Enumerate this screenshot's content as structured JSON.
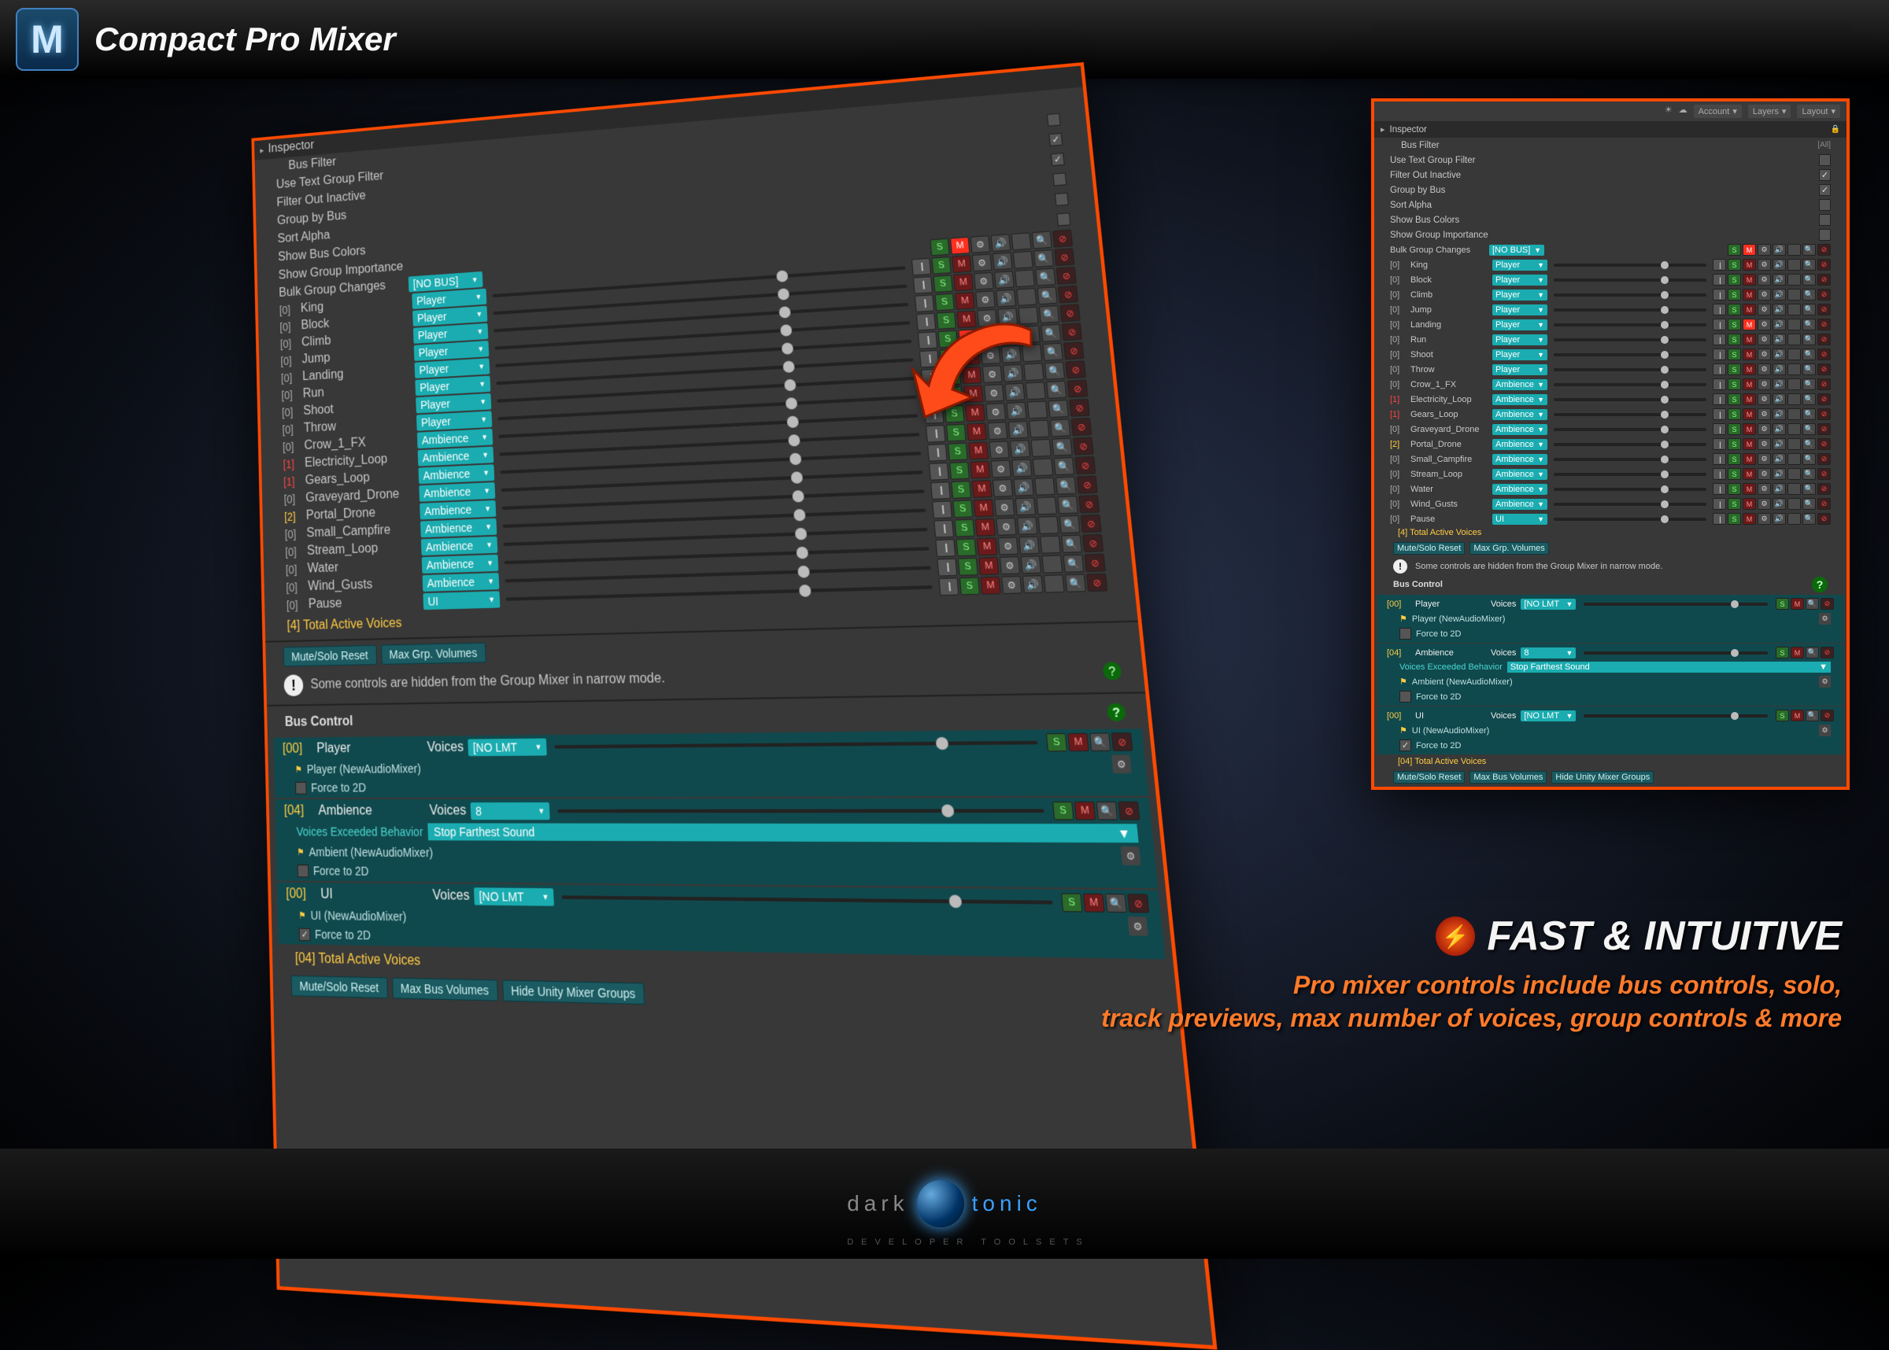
{
  "title": "Compact Pro Mixer",
  "slogan_head": "FAST & INTUITIVE",
  "slogan_body": "Pro mixer controls include bus controls, solo,\ntrack previews, max number of voices, group controls & more",
  "brand_left": "dark",
  "brand_right": "tonic",
  "brand_sub": "DEVELOPER  TOOLSETS",
  "inspector_label": "Inspector",
  "bus_filter_label": "Bus Filter",
  "toolbar": {
    "account": "Account",
    "layers": "Layers",
    "layout": "Layout"
  },
  "options": [
    {
      "label": "Use Text Group Filter",
      "checked": false
    },
    {
      "label": "Filter Out Inactive",
      "checked": true
    },
    {
      "label": "Group by Bus",
      "checked": true
    },
    {
      "label": "Sort Alpha",
      "checked": false
    },
    {
      "label": "Show Bus Colors",
      "checked": false
    },
    {
      "label": "Show Group Importance",
      "checked": false
    }
  ],
  "bulk_label": "Bulk Group Changes",
  "no_bus": "[NO BUS]",
  "tracks": [
    {
      "cnt": "[0]",
      "name": "King",
      "bus": "Player",
      "m": false
    },
    {
      "cnt": "[0]",
      "name": "Block",
      "bus": "Player",
      "m": false
    },
    {
      "cnt": "[0]",
      "name": "Climb",
      "bus": "Player",
      "m": false
    },
    {
      "cnt": "[0]",
      "name": "Jump",
      "bus": "Player",
      "m": false
    },
    {
      "cnt": "[0]",
      "name": "Landing",
      "bus": "Player",
      "m": true
    },
    {
      "cnt": "[0]",
      "name": "Run",
      "bus": "Player",
      "m": false
    },
    {
      "cnt": "[0]",
      "name": "Shoot",
      "bus": "Player",
      "m": false
    },
    {
      "cnt": "[0]",
      "name": "Throw",
      "bus": "Player",
      "m": false
    },
    {
      "cnt": "[0]",
      "name": "Crow_1_FX",
      "bus": "Ambience",
      "m": false
    },
    {
      "cnt": "[1]",
      "cls": "r",
      "name": "Electricity_Loop",
      "bus": "Ambience",
      "m": false
    },
    {
      "cnt": "[1]",
      "cls": "r",
      "name": "Gears_Loop",
      "bus": "Ambience",
      "m": false
    },
    {
      "cnt": "[0]",
      "name": "Graveyard_Drone",
      "bus": "Ambience",
      "m": false
    },
    {
      "cnt": "[2]",
      "cls": "y",
      "name": "Portal_Drone",
      "bus": "Ambience",
      "m": false
    },
    {
      "cnt": "[0]",
      "name": "Small_Campfire",
      "bus": "Ambience",
      "m": false
    },
    {
      "cnt": "[0]",
      "name": "Stream_Loop",
      "bus": "Ambience",
      "m": false
    },
    {
      "cnt": "[0]",
      "name": "Water",
      "bus": "Ambience",
      "m": false
    },
    {
      "cnt": "[0]",
      "name": "Wind_Gusts",
      "bus": "Ambience",
      "m": false
    },
    {
      "cnt": "[0]",
      "name": "Pause",
      "bus": "UI",
      "m": false
    }
  ],
  "tav": "[4] Total Active Voices",
  "buttons": {
    "msreset": "Mute/Solo Reset",
    "maxgrp": "Max Grp. Volumes",
    "maxbus": "Max Bus Volumes",
    "hideunity": "Hide Unity Mixer Groups"
  },
  "warn": "Some controls are hidden from the Group Mixer in narrow mode.",
  "bus_control": "Bus Control",
  "voices_label": "Voices",
  "nolmt": "[NO LMT",
  "force2d": "Force to 2D",
  "veb": "Voices Exceeded Behavior",
  "stopfar": "Stop Farthest Sound",
  "buses": [
    {
      "cnt": "[00]",
      "name": "Player",
      "mixer": "Player (NewAudioMixer)",
      "voices_dd": "[NO LMT",
      "force_checked": false,
      "voi": "[NO LMT"
    },
    {
      "cnt": "[04]",
      "name": "Ambience",
      "mixer": "Ambient (NewAudioMixer)",
      "voices_dd": "8",
      "force_checked": false,
      "veb": true
    },
    {
      "cnt": "[00]",
      "name": "UI",
      "mixer": "UI (NewAudioMixer)",
      "voices_dd": "[NO LMT",
      "force_checked": true
    }
  ],
  "tav2": "[04] Total Active Voices"
}
